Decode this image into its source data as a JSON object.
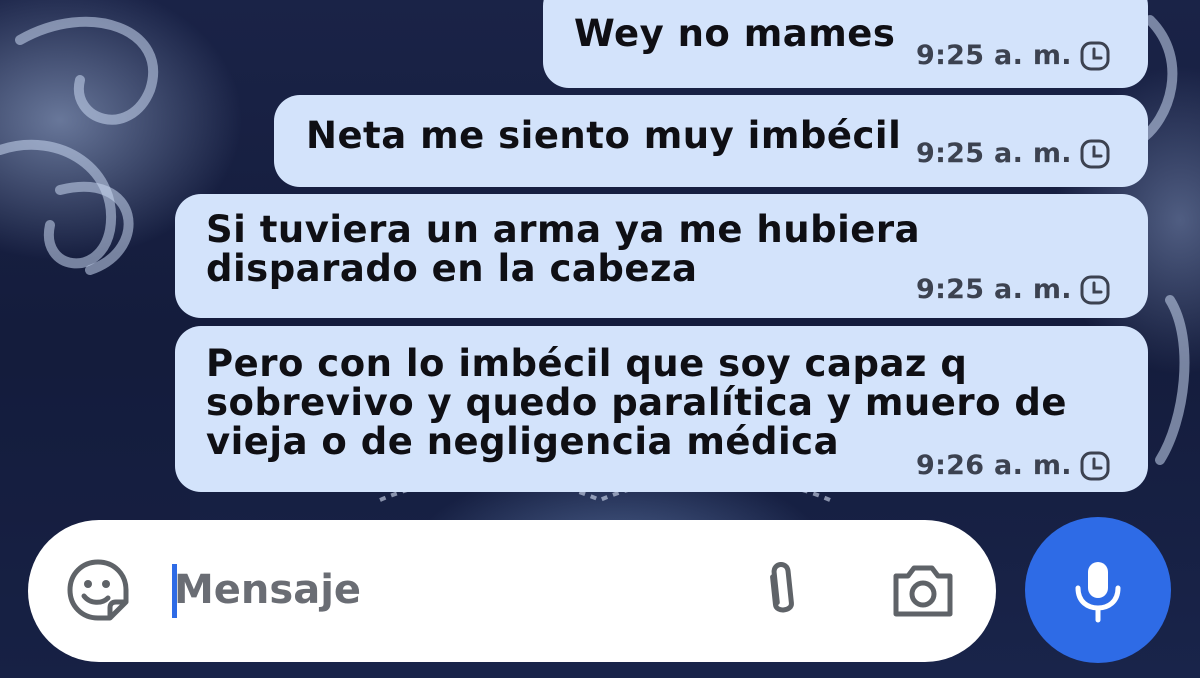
{
  "messages": [
    {
      "text": "Wey no mames",
      "time": "9:25 a. m.",
      "status_icon": "clock-pending-icon"
    },
    {
      "text": "Neta me siento muy imbécil",
      "time": "9:25 a. m.",
      "status_icon": "clock-pending-icon"
    },
    {
      "text": "Si tuviera un arma ya me hubiera\ndisparado en la cabeza",
      "time": "9:25 a. m.",
      "status_icon": "clock-pending-icon"
    },
    {
      "text": "Pero con lo imbécil que soy capaz q\nsobrevivo y quedo paralítica y muero de\nvieja o de negligencia médica",
      "time": "9:26 a. m.",
      "status_icon": "clock-pending-icon"
    }
  ],
  "composer": {
    "placeholder": "Mensaje",
    "value": "",
    "icons": [
      "sticker-icon",
      "attach-icon",
      "camera-icon"
    ]
  },
  "mic_button": {
    "icon": "microphone-icon"
  },
  "colors": {
    "bubble_bg": "#d3e3fb",
    "accent": "#2e6be6",
    "composer_bg": "#ffffff"
  }
}
